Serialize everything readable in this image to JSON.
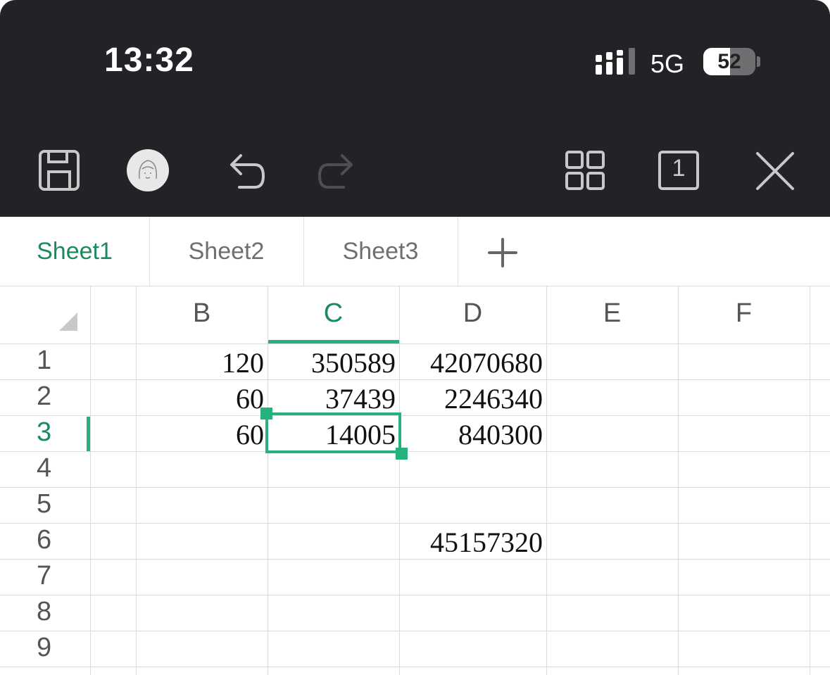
{
  "status_bar": {
    "time": "13:32",
    "network": "5G",
    "battery": "52",
    "battery_level": 0.52
  },
  "toolbar": {
    "icons": [
      "save-icon",
      "avatar",
      "undo-icon",
      "redo-icon",
      "grid-view-icon",
      "page-count-icon",
      "close-icon"
    ],
    "page_count": "1"
  },
  "tabs": [
    {
      "label": "Sheet1",
      "active": true
    },
    {
      "label": "Sheet2",
      "active": false
    },
    {
      "label": "Sheet3",
      "active": false
    }
  ],
  "add_sheet_icon": "plus-icon",
  "columns": [
    "B",
    "C",
    "D",
    "E",
    "F"
  ],
  "active_column": "C",
  "rows": [
    "1",
    "2",
    "3",
    "4",
    "5",
    "6",
    "7",
    "8",
    "9"
  ],
  "active_row": "3",
  "cells": {
    "B1": "120",
    "C1": "350589",
    "D1": "42070680",
    "B2": "60",
    "C2": "37439",
    "D2": "2246340",
    "B3": "60",
    "C3": "14005",
    "D3": "840300",
    "D6": "45157320"
  },
  "selected_cell": "C3",
  "colors": {
    "accent": "#1c8a5f",
    "selection": "#25b27c",
    "toolbar_bg": "#222326"
  }
}
